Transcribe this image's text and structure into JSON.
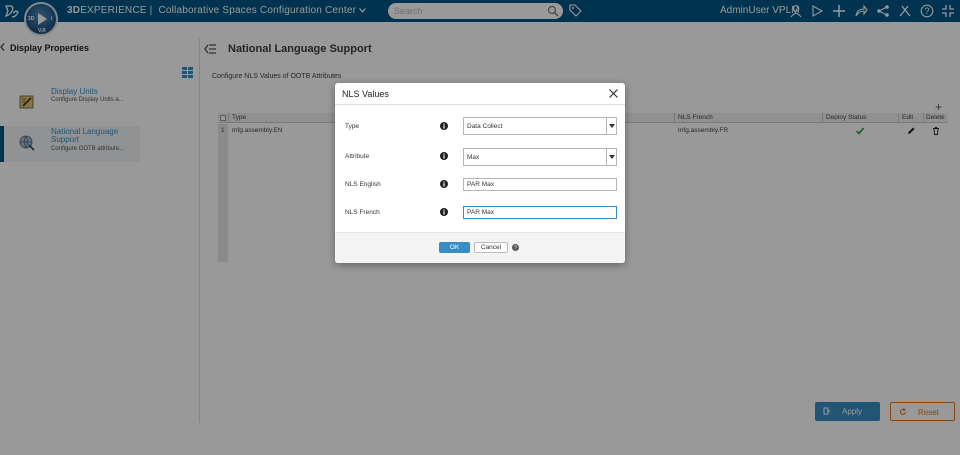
{
  "topbar": {
    "brand_bold": "3D",
    "brand_rest": "EXPERIENCE",
    "app_title": "Collaborative Spaces Configuration Center",
    "search_placeholder": "Search",
    "user": "AdminUser VPLM",
    "compass_labels": {
      "left": "3D",
      "right": "i",
      "bottom": "V,R"
    },
    "icons": [
      "user-icon",
      "share-play-icon",
      "add-icon",
      "share-icon",
      "network-icon",
      "tools-icon",
      "help-icon",
      "collapse-icon"
    ]
  },
  "left_panel": {
    "title": "Display Properties",
    "items": [
      {
        "title": "Display Units",
        "subtitle": "Configure Display Units a..."
      },
      {
        "title_line1": "National Language",
        "title_line2": "Support",
        "subtitle": "Configure OOTB attribute..."
      }
    ]
  },
  "main": {
    "title": "National Language Support",
    "description": "Configure NLS Values of OOTB Attributes",
    "columns": [
      "Type",
      "NLS French",
      "Deploy Status",
      "Edit",
      "Delete"
    ],
    "rows": [
      {
        "num": "1",
        "type": "mfg.assembly.EN",
        "french": "mfg.assembly.FR"
      }
    ],
    "apply_label": "Apply",
    "reset_label": "Reset"
  },
  "dialog": {
    "title": "NLS Values",
    "fields": {
      "type_label": "Type",
      "type_value": "Data Collect",
      "attribute_label": "Attribute",
      "attribute_value": "Max",
      "nls_english_label": "NLS English",
      "nls_english_value": "PAR Max",
      "nls_french_label": "NLS French",
      "nls_french_value": "PAR Max"
    },
    "ok_label": "OK",
    "cancel_label": "Cancel"
  },
  "colors": {
    "topbar": "#005686",
    "accent": "#368ec4",
    "reset": "#e87511",
    "check": "#2e8b3a"
  }
}
